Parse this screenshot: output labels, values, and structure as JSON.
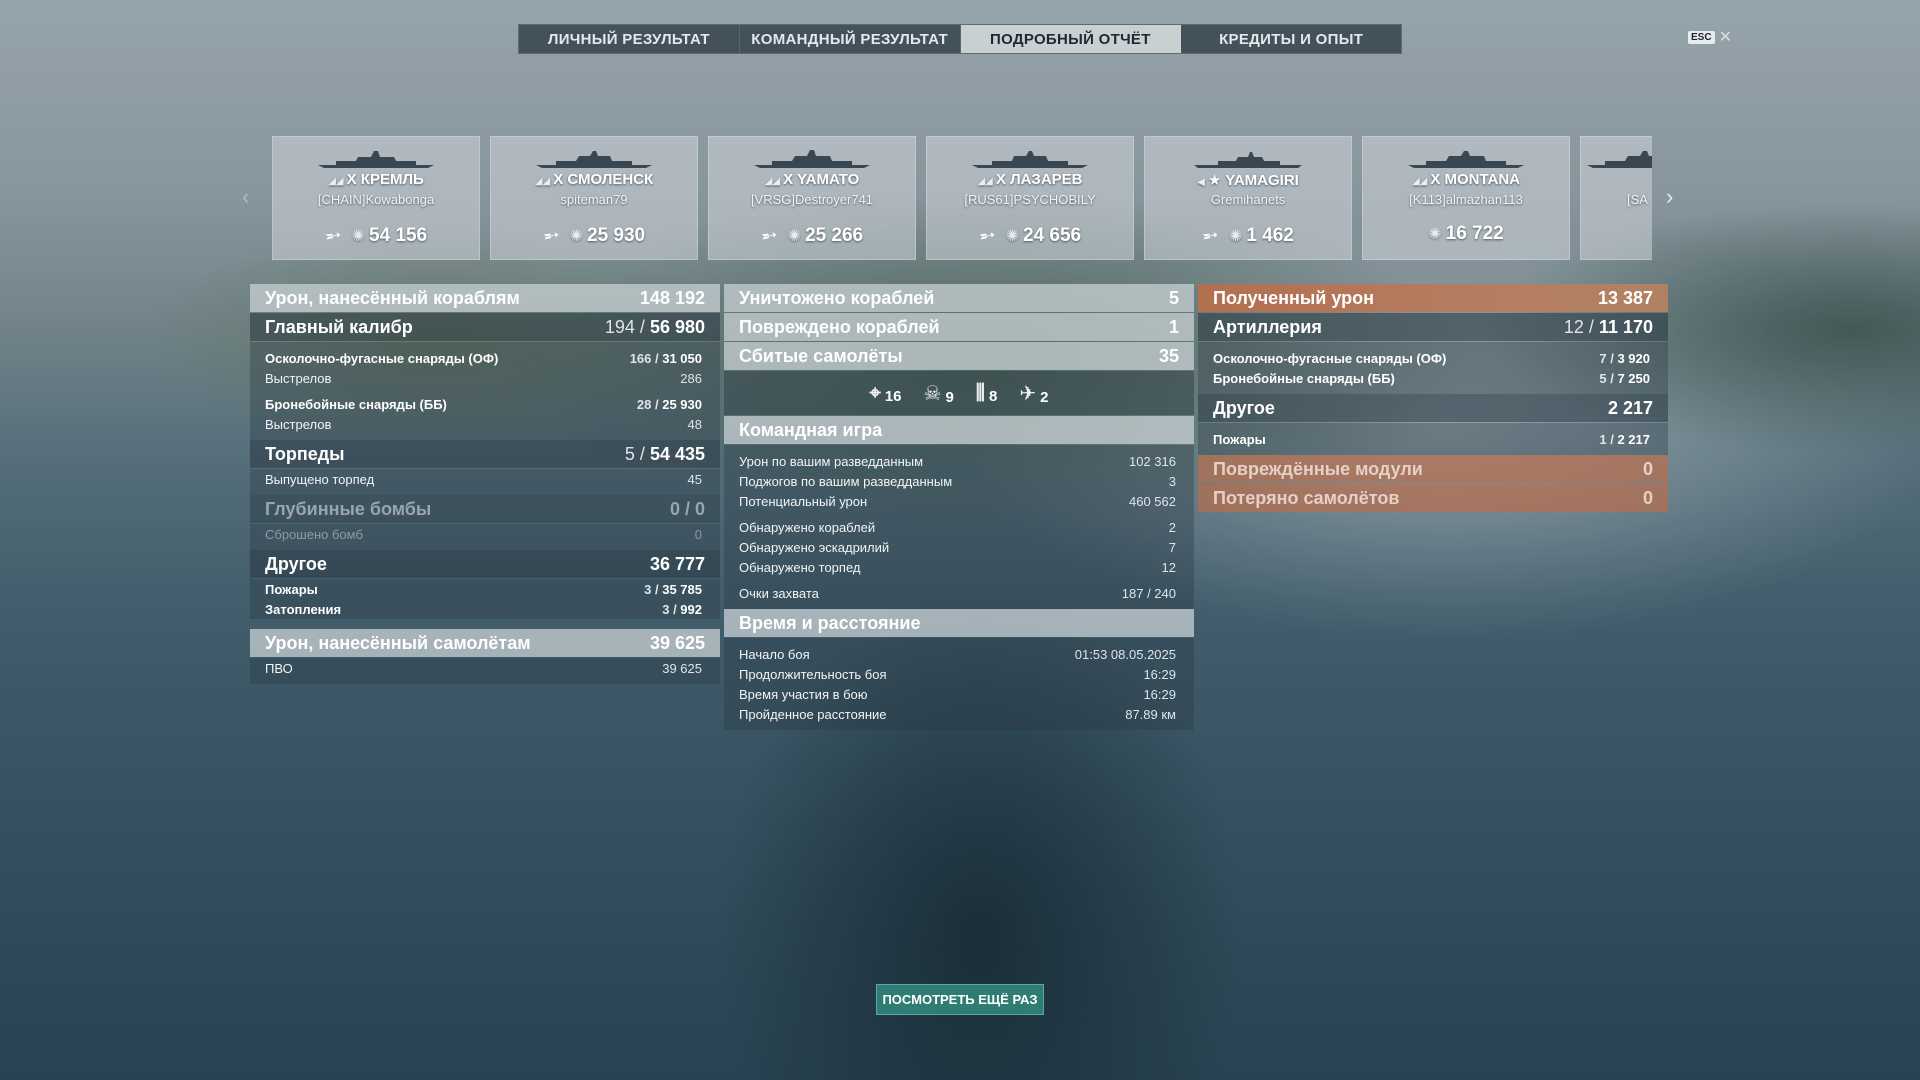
{
  "tabs": [
    "ЛИЧНЫЙ РЕЗУЛЬТАТ",
    "КОМАНДНЫЙ РЕЗУЛЬТАТ",
    "ПОДРОБНЫЙ ОТЧЁТ",
    "КРЕДИТЫ И ОПЫТ"
  ],
  "active_tab": "ПОДРОБНЫЙ ОТЧЁТ",
  "esc": {
    "key": "ESC",
    "close": "✕"
  },
  "ships": [
    {
      "tier": "X",
      "name": "КРЕМЛЬ",
      "player": "[CHAIN]Kowabonga",
      "damage": "54 156",
      "torpedo_icon": true
    },
    {
      "tier": "X",
      "name": "СМОЛЕНСК",
      "player": "spiteman79",
      "damage": "25 930",
      "torpedo_icon": true
    },
    {
      "tier": "X",
      "name": "YAMATO",
      "player": "[VRSG]Destroyer741",
      "damage": "25 266",
      "torpedo_icon": true
    },
    {
      "tier": "X",
      "name": "ЛАЗАРЕВ",
      "player": "[RUS61]PSYCHOBILY",
      "damage": "24 656",
      "torpedo_icon": true
    },
    {
      "tier": "★",
      "name": "YAMAGIRI",
      "player": "Gremihanets",
      "damage": "1 462",
      "torpedo_icon": true
    },
    {
      "tier": "X",
      "name": "MONTANA",
      "player": "[K113]almazhan113",
      "damage": "16 722",
      "torpedo_icon": false
    },
    {
      "tier": "",
      "name": "",
      "player": "[SA",
      "damage": "",
      "torpedo_icon": false
    }
  ],
  "left": {
    "ship_damage": {
      "label": "Урон, нанесённый кораблям",
      "value": "148 192"
    },
    "main_battery": {
      "label": "Главный калибр",
      "hits": "194",
      "damage": "56 980"
    },
    "he": {
      "label": "Осколочно-фугасные снаряды (ОФ)",
      "hits": "166",
      "damage": "31 050"
    },
    "he_shots": {
      "label": "Выстрелов",
      "value": "286"
    },
    "ap": {
      "label": "Бронебойные снаряды (ББ)",
      "hits": "28",
      "damage": "25 930"
    },
    "ap_shots": {
      "label": "Выстрелов",
      "value": "48"
    },
    "torpedoes": {
      "label": "Торпеды",
      "hits": "5",
      "damage": "54 435"
    },
    "torp_launched": {
      "label": "Выпущено торпед",
      "value": "45"
    },
    "depth": {
      "label": "Глубинные бомбы",
      "hits": "0",
      "damage": "0"
    },
    "depth_dropped": {
      "label": "Сброшено бомб",
      "value": "0"
    },
    "other": {
      "label": "Другое",
      "value": "36 777"
    },
    "fires": {
      "label": "Пожары",
      "count": "3",
      "damage": "35 785"
    },
    "floods": {
      "label": "Затопления",
      "count": "3",
      "damage": "992"
    },
    "plane_damage": {
      "label": "Урон, нанесённый самолётам",
      "value": "39 625"
    },
    "aa": {
      "label": "ПВО",
      "value": "39 625"
    }
  },
  "mid": {
    "destroyed": {
      "label": "Уничтожено кораблей",
      "value": "5"
    },
    "damaged": {
      "label": "Повреждено кораблей",
      "value": "1"
    },
    "planes_down": {
      "label": "Сбитые самолёты",
      "value": "35"
    },
    "plane_types": [
      {
        "icon": "crosshair",
        "value": "16"
      },
      {
        "icon": "skull",
        "value": "9"
      },
      {
        "icon": "bombs",
        "value": "8"
      },
      {
        "icon": "squadron",
        "value": "2"
      }
    ],
    "team": {
      "label": "Командная игра"
    },
    "spot_damage": {
      "label": "Урон по вашим разведданным",
      "value": "102 316"
    },
    "spot_fires": {
      "label": "Поджогов по вашим разведданным",
      "value": "3"
    },
    "potential": {
      "label": "Потенциальный урон",
      "value": "460 562"
    },
    "spotted_ships": {
      "label": "Обнаружено кораблей",
      "value": "2"
    },
    "spotted_sq": {
      "label": "Обнаружено эскадрилий",
      "value": "7"
    },
    "spotted_torp": {
      "label": "Обнаружено торпед",
      "value": "12"
    },
    "capture": {
      "label": "Очки захвата",
      "value": "187 / 240"
    },
    "time": {
      "label": "Время и расстояние"
    },
    "start": {
      "label": "Начало боя",
      "value": "01:53  08.05.2025"
    },
    "duration": {
      "label": "Продолжительность боя",
      "value": "16:29"
    },
    "participation": {
      "label": "Время участия в бою",
      "value": "16:29"
    },
    "distance": {
      "label": "Пройденное расстояние",
      "value": "87.89 км"
    }
  },
  "right": {
    "received": {
      "label": "Полученный урон",
      "value": "13 387"
    },
    "artillery": {
      "label": "Артиллерия",
      "hits": "12",
      "damage": "11 170"
    },
    "he": {
      "label": "Осколочно-фугасные снаряды (ОФ)",
      "hits": "7",
      "damage": "3 920"
    },
    "ap": {
      "label": "Бронебойные снаряды (ББ)",
      "hits": "5",
      "damage": "7 250"
    },
    "other": {
      "label": "Другое",
      "value": "2 217"
    },
    "fires": {
      "label": "Пожары",
      "count": "1",
      "damage": "2 217"
    },
    "modules": {
      "label": "Повреждённые модули",
      "value": "0"
    },
    "planes_lost": {
      "label": "Потеряно самолётов",
      "value": "0"
    }
  },
  "replay_button": "ПОСМОТРЕТЬ ЕЩЁ РАЗ",
  "colors": {
    "accent": "#2f7c74",
    "received": "#b96e4b"
  }
}
